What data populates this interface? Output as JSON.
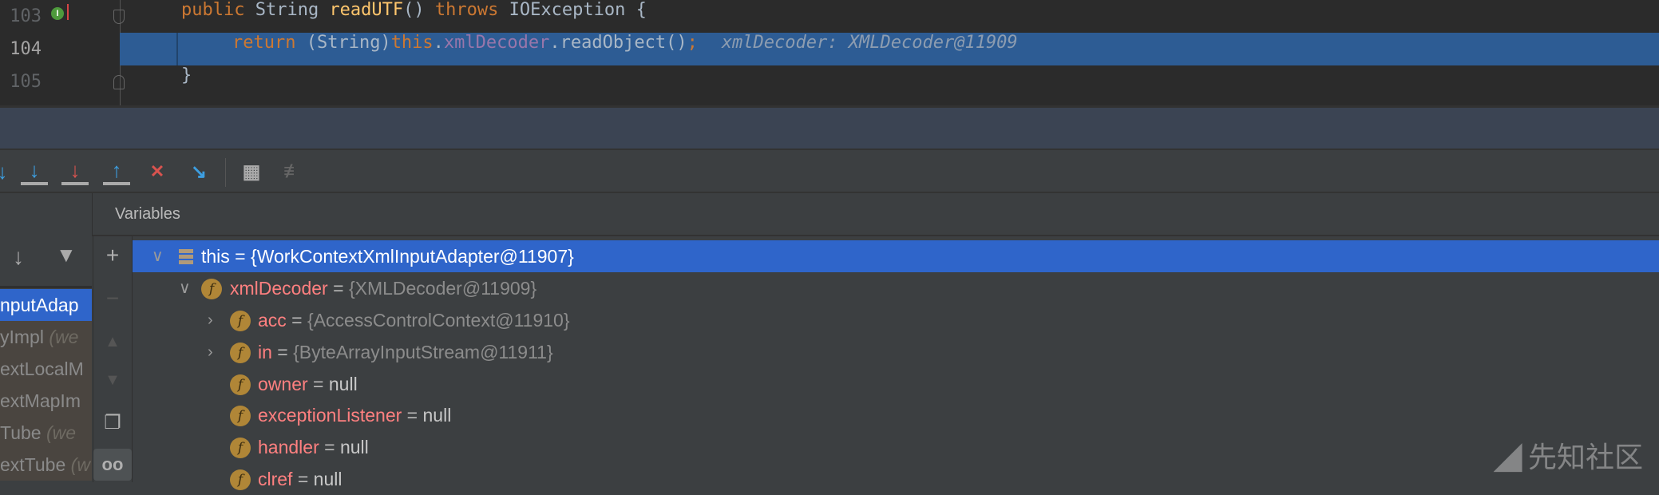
{
  "editor": {
    "lines": [
      {
        "num": "103",
        "tokens": [
          "public ",
          "String ",
          "readUTF",
          "() ",
          "throws ",
          "IOException {"
        ]
      },
      {
        "num": "104",
        "tokens": [
          "return ",
          "(String)",
          "this",
          ".",
          "xmlDecoder",
          ".readObject()",
          ";"
        ],
        "hint": "xmlDecoder: XMLDecoder@11909"
      },
      {
        "num": "105",
        "tokens": [
          "}"
        ]
      }
    ]
  },
  "toolbar": {
    "icons": [
      "step-over-icon",
      "step-into-icon",
      "force-step-into-icon",
      "step-out-icon",
      "drop-frame-icon",
      "run-to-cursor-icon",
      "evaluate-expression-icon",
      "trace-stream-icon"
    ]
  },
  "panel": {
    "title": "Variables"
  },
  "frames": [
    {
      "name": "nputAdap",
      "extra": ""
    },
    {
      "name": "yImpl ",
      "extra": "(we"
    },
    {
      "name": "extLocalM",
      "extra": ""
    },
    {
      "name": "extMapIm",
      "extra": ""
    },
    {
      "name": "Tube ",
      "extra": "(we"
    },
    {
      "name": "extTube ",
      "extra": "(w"
    }
  ],
  "variables": [
    {
      "name": "this",
      "value": "{WorkContextXmlInputAdapter@11907}"
    },
    {
      "name": "xmlDecoder",
      "value": "{XMLDecoder@11909}"
    },
    {
      "name": "acc",
      "value": "{AccessControlContext@11910}"
    },
    {
      "name": "in",
      "value": "{ByteArrayInputStream@11911}"
    },
    {
      "name": "owner",
      "value": "null"
    },
    {
      "name": "exceptionListener",
      "value": "null"
    },
    {
      "name": "handler",
      "value": "null"
    },
    {
      "name": "clref",
      "value": "null"
    }
  ],
  "equals": " = ",
  "watermark": "先知社区",
  "colors": {
    "selection": "#2f65ca",
    "current_line": "#2d5c94",
    "field_name": "#ff8080"
  }
}
